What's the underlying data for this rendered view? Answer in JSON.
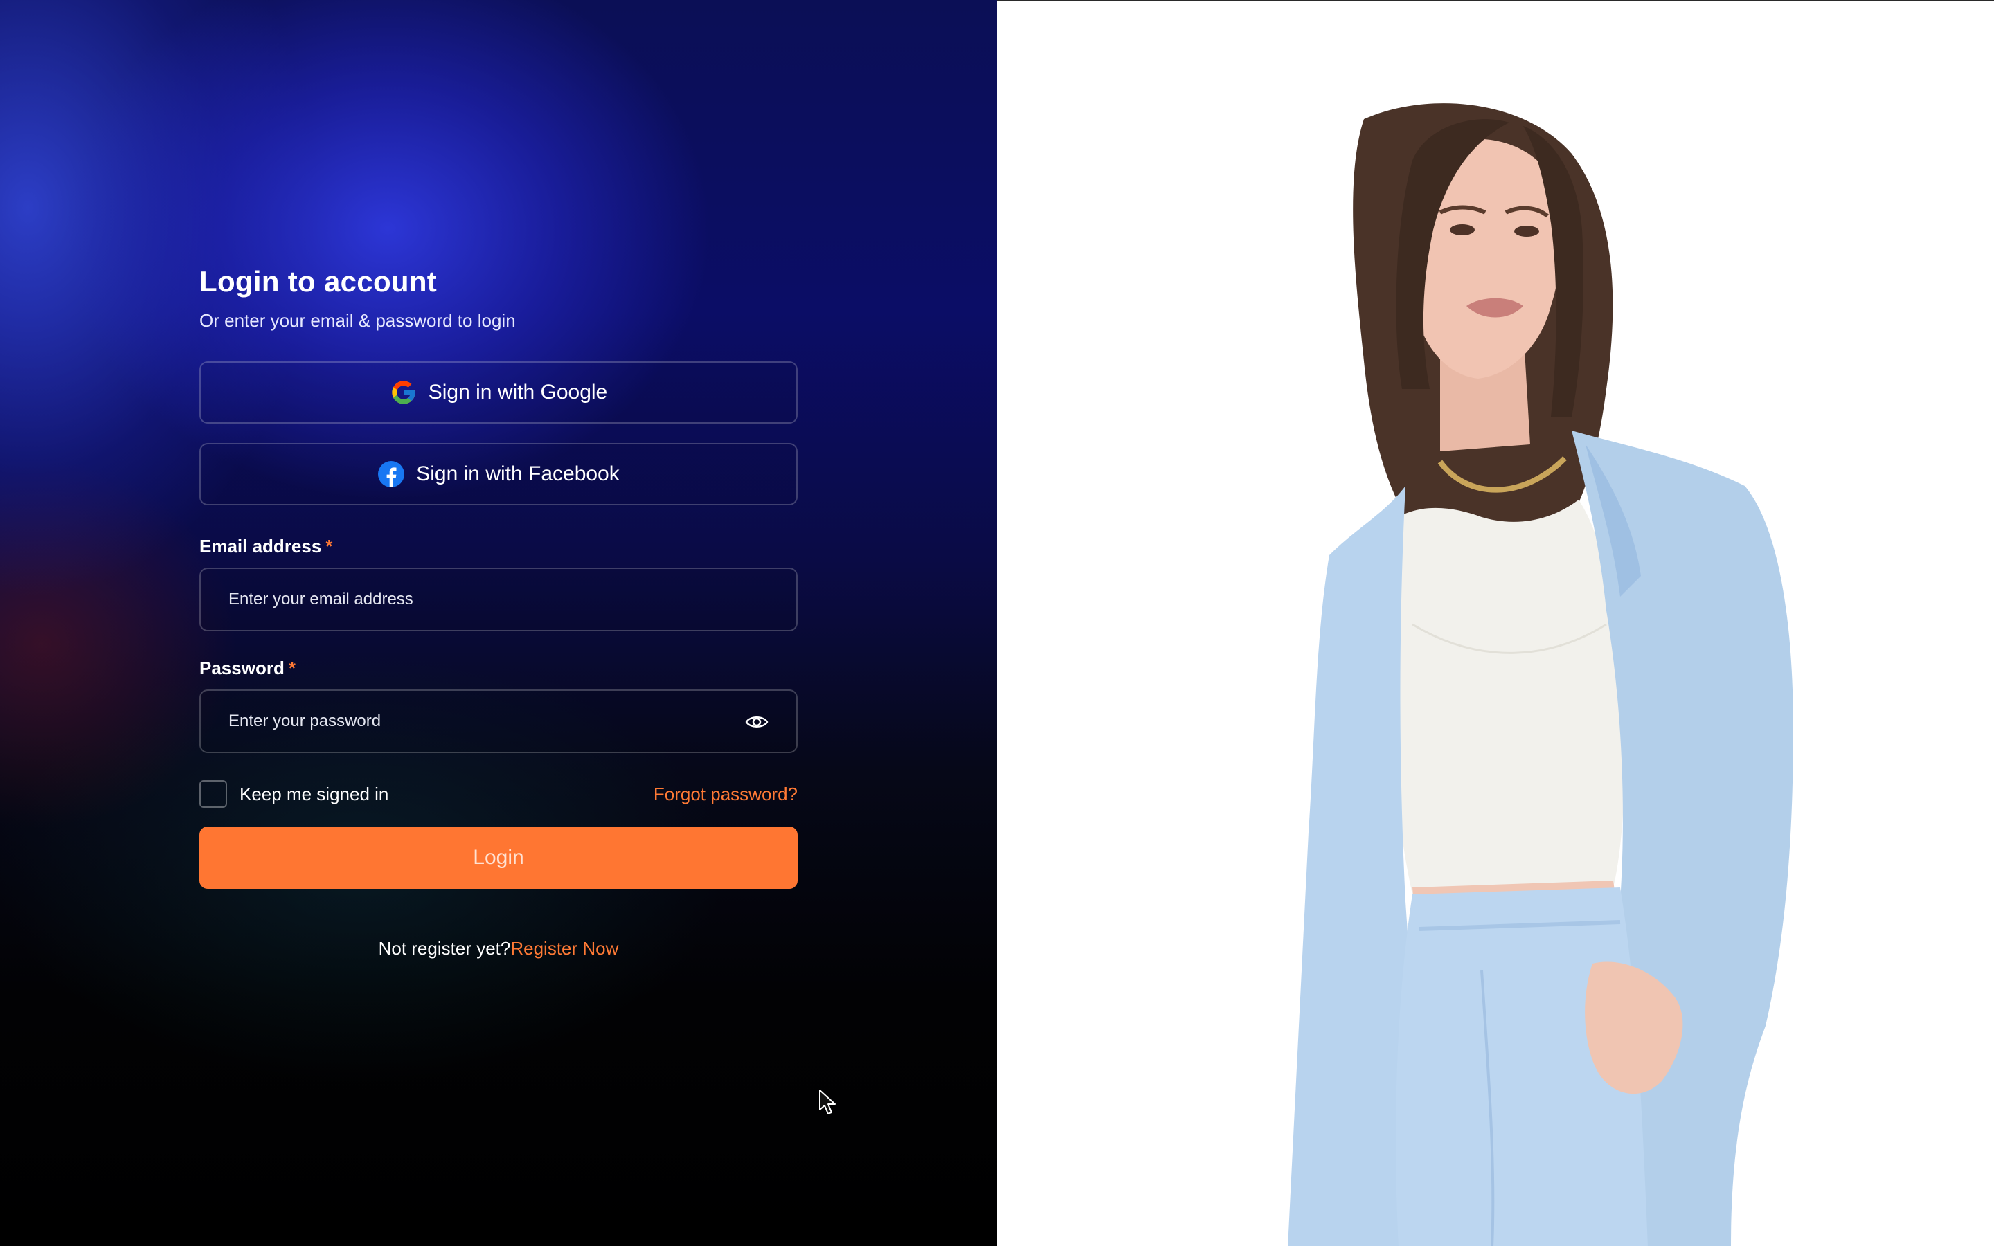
{
  "login": {
    "title": "Login to account",
    "subtitle": "Or enter your email & password to login",
    "google_button": "Sign in with Google",
    "facebook_button": "Sign in with Facebook",
    "email": {
      "label": "Email address",
      "required_mark": "*",
      "placeholder": "Enter your email address",
      "value": ""
    },
    "password": {
      "label": "Password",
      "required_mark": "*",
      "placeholder": "Enter your password",
      "value": ""
    },
    "keep_signed_in": {
      "label": "Keep me signed in",
      "checked": false
    },
    "forgot_password": "Forgot password?",
    "login_button": "Login",
    "register_prompt": "Not register yet?",
    "register_link": "Register Now"
  },
  "icons": {
    "google": "google-logo-icon",
    "facebook": "facebook-logo-icon",
    "password_toggle": "eye-icon",
    "cursor": "mouse-pointer-icon"
  },
  "colors": {
    "accent": "#ff7632",
    "link": "#ff7a35",
    "panel_dark": "#000000",
    "panel_blue": "#2a33d6",
    "photo_background": "#ffffff"
  }
}
